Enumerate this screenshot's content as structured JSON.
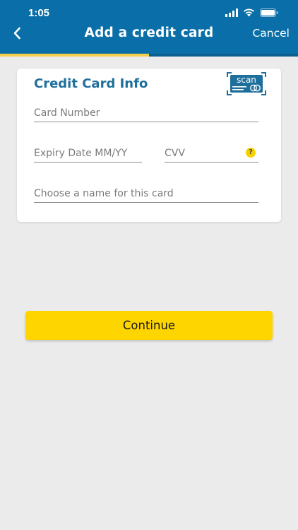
{
  "status_bar": {
    "time": "1:05",
    "icons": [
      "signal-icon",
      "wifi-icon",
      "battery-icon"
    ]
  },
  "nav": {
    "back_icon": "chevron-left-icon",
    "title": "Add a credit card",
    "cancel_label": "Cancel"
  },
  "progress": {
    "fraction": 0.5
  },
  "card": {
    "title": "Credit Card Info",
    "scan_label": "scan",
    "fields": {
      "card_number_placeholder": "Card Number",
      "expiry_placeholder": "Expiry Date MM/YY",
      "cvv_placeholder": "CVV",
      "cvv_help": "?",
      "name_placeholder": "Choose a name for this card"
    }
  },
  "actions": {
    "continue_label": "Continue"
  },
  "colors": {
    "header_bg": "#0a6fa8",
    "title_blue": "#1f6f9c",
    "accent_yellow": "#ffd500",
    "progress_fill": "#f6d04d",
    "background": "#ebebeb"
  }
}
